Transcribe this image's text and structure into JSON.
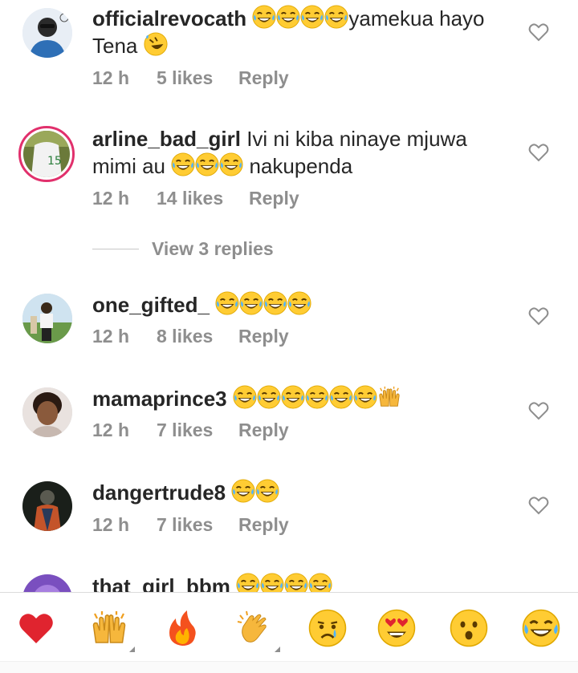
{
  "comments": [
    {
      "username": "officialrevocath",
      "text_before": "",
      "emoji_count": 4,
      "text_after": "yamekua hayo",
      "line2_text": "Tena",
      "line2_emoji": 1,
      "time": "12 h",
      "likes": "5 likes",
      "reply": "Reply"
    },
    {
      "username": "arline_bad_girl",
      "text": "Ivi ni kiba ninaye mjuwa",
      "line2_text": "mimi au",
      "line2_emoji": 3,
      "line2_after": "nakupenda",
      "time": "12 h",
      "likes": "14 likes",
      "reply": "Reply"
    },
    {
      "username": "one_gifted_",
      "emoji_count": 4,
      "time": "12 h",
      "likes": "8 likes",
      "reply": "Reply"
    },
    {
      "username": "mamaprince3",
      "emoji_count": 6,
      "extra_icon": "raised-hands-icon",
      "time": "12 h",
      "likes": "7 likes",
      "reply": "Reply"
    },
    {
      "username": "dangertrude8",
      "emoji_count": 2,
      "time": "12 h",
      "likes": "7 likes",
      "reply": "Reply"
    },
    {
      "username": "that_girl_bbm",
      "emoji_count": 4
    }
  ],
  "view_replies": "View 3 replies",
  "reactions": [
    "red-heart-icon",
    "raised-hands-icon",
    "fire-icon",
    "clapping-hands-icon",
    "crying-face-icon",
    "heart-eyes-icon",
    "surprised-face-icon",
    "tears-of-joy-icon"
  ],
  "colors": {
    "text": "#262626",
    "muted": "#8e8e8e",
    "story_ring": "#e1306c",
    "emoji_yellow": "#ffcc33"
  }
}
